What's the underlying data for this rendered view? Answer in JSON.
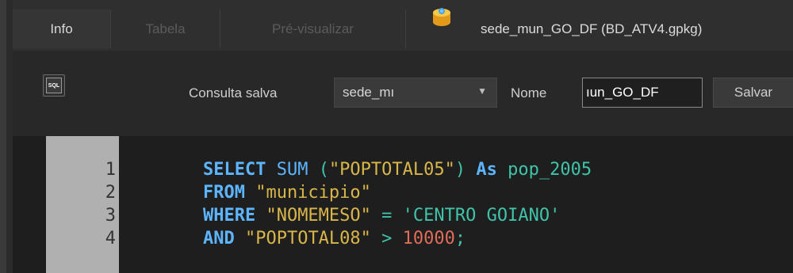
{
  "tabs": [
    {
      "label": "Info",
      "active": true
    },
    {
      "label": "Tabela",
      "active": false
    },
    {
      "label": "Pré-visualizar",
      "active": false
    }
  ],
  "title": "sede_mun_GO_DF (BD_ATV4.gpkg)",
  "title_icon": "database-icon",
  "toolbar": {
    "sql_icon_label": "SQL",
    "saved_query_label": "Consulta salva",
    "saved_query_value": "sede_mı",
    "name_label": "Nome",
    "name_value": "ıun_GO_DF",
    "save_label": "Salvar"
  },
  "editor": {
    "line_numbers": [
      "1",
      "2",
      "3",
      "4"
    ],
    "lines": [
      {
        "kw": "SELECT",
        "a": " SUM ",
        "b": "(",
        "c": "\"POPTOTAL05\"",
        "d": ")",
        "e": " As ",
        "f": "pop_2005"
      },
      {
        "kw": "FROM",
        "a": " ",
        "b": "",
        "c": "\"municipio\"",
        "d": "",
        "e": "",
        "f": ""
      },
      {
        "kw": "WHERE",
        "a": " ",
        "b": "",
        "c": "\"NOMEMESO\"",
        "d": " = ",
        "e": "'CENTRO GOIANO'",
        "f": ""
      },
      {
        "kw": "AND",
        "a": " ",
        "b": "",
        "c": "\"POPTOTAL08\"",
        "d": " > ",
        "e": "10000",
        "f": ";"
      }
    ]
  },
  "colors": {
    "keyword": "#5db5ff",
    "string": "#d9b64a",
    "literal": "#3fc3a9",
    "number": "#e06c5a"
  }
}
